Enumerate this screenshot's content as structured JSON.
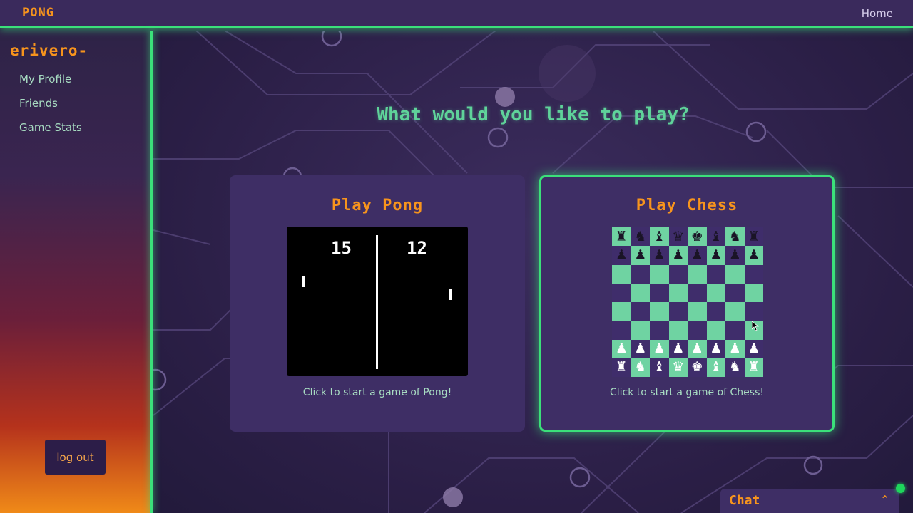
{
  "navbar": {
    "brand": "PONG",
    "home_label": "Home"
  },
  "sidebar": {
    "username": "erivero-",
    "items": [
      {
        "label": "My Profile"
      },
      {
        "label": "Friends"
      },
      {
        "label": "Game Stats"
      }
    ],
    "logout_label": "log out"
  },
  "main": {
    "title": "What would you like to play?",
    "cards": {
      "pong": {
        "title": "Play Pong",
        "description": "Click to start a game of Pong!",
        "preview": {
          "score_left": "15",
          "score_right": "12"
        }
      },
      "chess": {
        "title": "Play Chess",
        "description": "Click to start a game of Chess!",
        "preview": {
          "black_back_rank": [
            "♜",
            "♞",
            "♝",
            "♛",
            "♚",
            "♝",
            "♞",
            "♜"
          ],
          "black_pawns": [
            "♟",
            "♟",
            "♟",
            "♟",
            "♟",
            "♟",
            "♟",
            "♟"
          ],
          "white_pawns": [
            "♟",
            "♟",
            "♟",
            "♟",
            "♟",
            "♟",
            "♟",
            "♟"
          ],
          "white_back_rank": [
            "♜",
            "♞",
            "♝",
            "♛",
            "♚",
            "♝",
            "♞",
            "♜"
          ]
        }
      }
    }
  },
  "chat": {
    "label": "Chat",
    "status": "online"
  },
  "colors": {
    "accent_green": "#3be07a",
    "accent_orange": "#f7941d",
    "text_mint": "#a8dcc2",
    "card_bg": "#3e2e65"
  }
}
